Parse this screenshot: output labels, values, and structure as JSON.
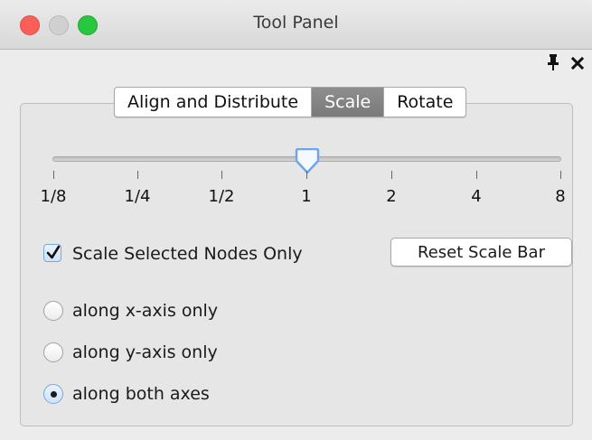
{
  "window": {
    "title": "Tool Panel"
  },
  "header_icons": [
    "pin-icon",
    "close-icon"
  ],
  "tabs": [
    {
      "label": "Align and Distribute",
      "active": false
    },
    {
      "label": "Scale",
      "active": true
    },
    {
      "label": "Rotate",
      "active": false
    }
  ],
  "scale": {
    "ticks": [
      "1/8",
      "1/4",
      "1/2",
      "1",
      "2",
      "4",
      "8"
    ],
    "selected_value": "1"
  },
  "options": {
    "scale_selected_only": {
      "label": "Scale Selected Nodes Only",
      "checked": true
    },
    "reset_label": "Reset Scale Bar"
  },
  "axes": [
    {
      "label": "along x-axis only",
      "checked": false
    },
    {
      "label": "along y-axis only",
      "checked": false
    },
    {
      "label": "along both axes",
      "checked": true
    }
  ],
  "colors": {
    "accent": "#7aa7d8",
    "active_tab": "#858585",
    "close": "#fc5f57",
    "maximize": "#29c63f"
  }
}
